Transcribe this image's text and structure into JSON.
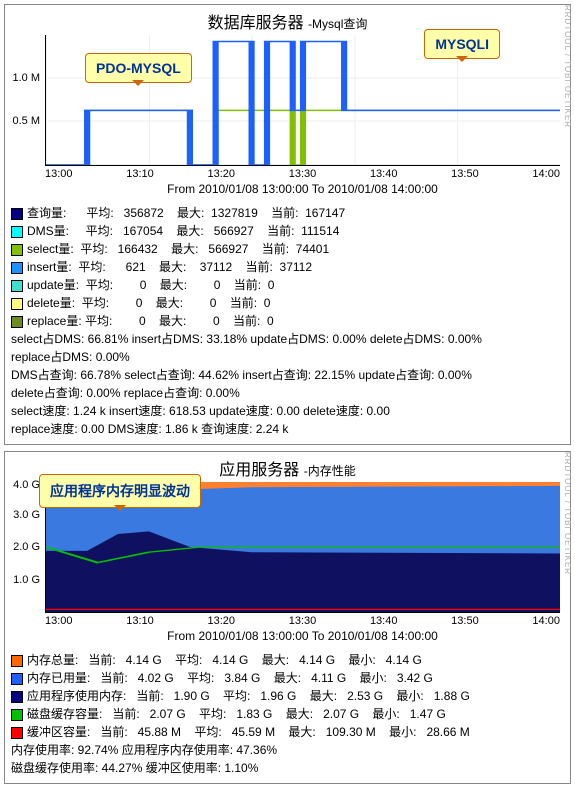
{
  "side_credit": "RRDTOOL / TOBI OETIKER",
  "panel1": {
    "title": "数据库服务器",
    "subtitle": "-Mysql查询",
    "callout_left": "PDO-MYSQL",
    "callout_right": "MYSQLI",
    "y_ticks": [
      "0.5 M",
      "1.0 M"
    ],
    "x_ticks": [
      "13:00",
      "13:10",
      "13:20",
      "13:30",
      "13:40",
      "13:50",
      "14:00"
    ],
    "timerange": "From 2010/01/08 13:00:00 To 2010/01/08 14:00:00",
    "rows": [
      {
        "color": "#000080",
        "label": "查询量:",
        "avg": "356872",
        "max": "1327819",
        "cur": "167147"
      },
      {
        "color": "#00ffff",
        "label": "DMS量:",
        "avg": "167054",
        "max": "566927",
        "cur": "111514"
      },
      {
        "color": "#80c000",
        "label": "select量:",
        "avg": "166432",
        "max": "566927",
        "cur": "74401"
      },
      {
        "color": "#1e90ff",
        "label": "insert量:",
        "avg": "621",
        "max": "37112",
        "cur": "37112"
      },
      {
        "color": "#40e0d0",
        "label": "update量:",
        "avg": "0",
        "max": "0",
        "cur": "0"
      },
      {
        "color": "#ffff80",
        "label": "delete量:",
        "avg": "0",
        "max": "0",
        "cur": "0"
      },
      {
        "color": "#6b8e23",
        "label": "replace量:",
        "avg": "0",
        "max": "0",
        "cur": "0"
      }
    ],
    "extra": [
      "select占DMS:  66.81%    insert占DMS:  33.18%    update占DMS:   0.00%    delete占DMS:   0.00%",
      "replace占DMS:   0.00%",
      "DMS占查询:  66.78%    select占查询:  44.62%    insert占查询:  22.15%    update占查询:   0.00%",
      "delete占查询:   0.00%    replace占查询:   0.00%",
      "select速度:   1.24 k    insert速度:  618.53    update速度:   0.00    delete速度:   0.00",
      "replace速度:   0.00      DMS速度:   1.86 k    查询速度:   2.24 k"
    ]
  },
  "panel2": {
    "title": "应用服务器",
    "subtitle": "-内存性能",
    "callout": "应用程序内存明显波动",
    "y_ticks": [
      "1.0 G",
      "2.0 G",
      "3.0 G",
      "4.0 G"
    ],
    "x_ticks": [
      "13:00",
      "13:10",
      "13:20",
      "13:30",
      "13:40",
      "13:50",
      "14:00"
    ],
    "timerange": "From 2010/01/08 13:00:00 To 2010/01/08 14:00:00",
    "rows": [
      {
        "color": "#ff6600",
        "label": "内存总量:",
        "cur": "4.14 G",
        "avg": "4.14 G",
        "max": "4.14 G",
        "min": "4.14 G"
      },
      {
        "color": "#1e60ff",
        "label": "内存已用量:",
        "cur": "4.02 G",
        "avg": "3.84 G",
        "max": "4.11 G",
        "min": "3.42 G"
      },
      {
        "color": "#000080",
        "label": "应用程序使用内存:",
        "cur": "1.90 G",
        "avg": "1.96 G",
        "max": "2.53 G",
        "min": "1.88 G"
      },
      {
        "color": "#00c000",
        "label": "磁盘缓存容量:",
        "cur": "2.07 G",
        "avg": "1.83 G",
        "max": "2.07 G",
        "min": "1.47 G"
      },
      {
        "color": "#ff0000",
        "label": "缓冲区容量:",
        "cur": "45.88 M",
        "avg": "45.59 M",
        "max": "109.30 M",
        "min": "28.66 M"
      }
    ],
    "extra": [
      "内存使用率:  92.74%    应用程序内存使用率:  47.36%",
      "磁盘缓存使用率:  44.27%    缓冲区使用率:   1.10%"
    ]
  },
  "chart_data": [
    {
      "type": "line",
      "title": "数据库服务器 -Mysql查询",
      "xlabel": "",
      "ylabel": "",
      "ylim": [
        0,
        1400000
      ],
      "x_ticks": [
        "13:00",
        "13:10",
        "13:20",
        "13:30",
        "13:40",
        "13:50",
        "14:00"
      ],
      "series": [
        {
          "name": "查询量 (blue)",
          "approx_values_M": [
            0,
            0,
            0.55,
            0.55,
            1.3,
            0,
            1.3,
            0.55,
            1.3,
            0.55,
            0.55,
            0.55,
            0.55
          ]
        },
        {
          "name": "select量 (green)",
          "approx_values_M": [
            0,
            0,
            0.55,
            0.55,
            0.55,
            0,
            0.55,
            0.55,
            0.55,
            0.55,
            0.55,
            0.55,
            0.55
          ]
        }
      ],
      "annotations": [
        "PDO-MYSQL",
        "MYSQLI"
      ]
    },
    {
      "type": "area",
      "title": "应用服务器 -内存性能",
      "xlabel": "",
      "ylabel": "",
      "ylim": [
        0,
        4.2
      ],
      "x_ticks": [
        "13:00",
        "13:10",
        "13:20",
        "13:30",
        "13:40",
        "13:50",
        "14:00"
      ],
      "series": [
        {
          "name": "内存总量",
          "color": "#ff6600",
          "value_G": 4.14
        },
        {
          "name": "内存已用量",
          "color": "#1e60ff",
          "value_G": 4.02
        },
        {
          "name": "应用程序使用内存",
          "color": "#000080",
          "value_G": 1.9
        },
        {
          "name": "磁盘缓存容量 (line)",
          "color": "#00c000",
          "value_G": 2.07
        },
        {
          "name": "缓冲区容量 (line)",
          "color": "#ff0000",
          "value_M": 45.88
        }
      ],
      "annotations": [
        "应用程序内存明显波动"
      ]
    }
  ]
}
